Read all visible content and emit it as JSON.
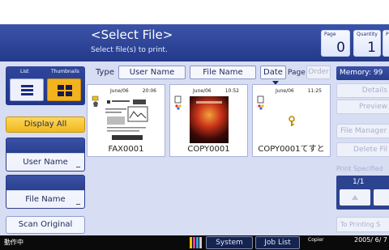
{
  "header": {
    "title": "<Select File>",
    "subtitle": "Select file(s) to print.",
    "page": {
      "label": "Page",
      "value": "0"
    },
    "quantity": {
      "label": "Quantity",
      "value": "1"
    },
    "cut_label": "P"
  },
  "left": {
    "view_list_label": "List",
    "view_thumb_label": "Thumbnails",
    "display_all": "Display All",
    "user_name": "User Name",
    "file_name": "File Name",
    "scan_original": "Scan Original"
  },
  "columns": {
    "type": "Type",
    "user_name": "User Name",
    "file_name": "File Name",
    "date": "Date",
    "page": "Page",
    "order": "Order"
  },
  "files": [
    {
      "date": "June/06",
      "time": "20:06",
      "name": "FAX0001"
    },
    {
      "date": "June/06",
      "time": "10:52",
      "name": "COPY0001"
    },
    {
      "date": "June/06",
      "time": "11:25",
      "name": "COPY0001てすと"
    }
  ],
  "right": {
    "memory": "Memory: 99",
    "details": "Details",
    "preview": "Preview",
    "file_management": "File Manager",
    "delete_file": "Delete Fil",
    "print_specified": "Print Specified",
    "pager": "1/1",
    "to_printing": "To Printing S"
  },
  "status": {
    "left_text": "動作中",
    "system_status": "System Status",
    "job_list": "Job List",
    "copier": "Copier",
    "datetime": "2005/ 6/ 7"
  },
  "colors": {
    "header": "#2e469c",
    "panel": "#d7ddf2",
    "accent_yellow": "#f3b31e"
  }
}
